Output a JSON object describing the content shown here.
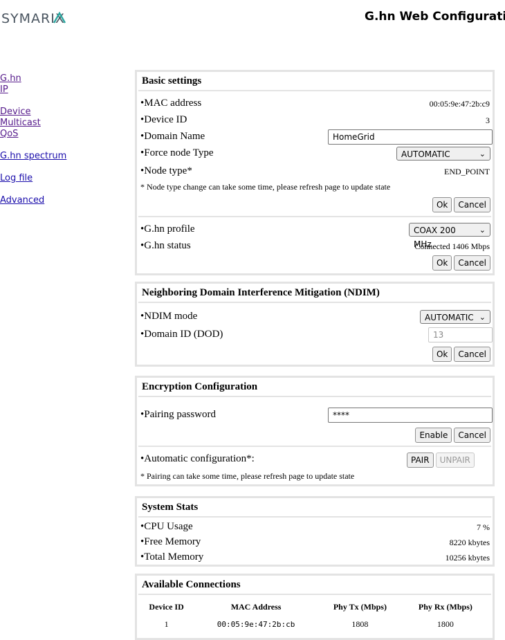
{
  "header": {
    "logo_text": "SYMARIX",
    "title": "G.hn Web Configuratio"
  },
  "nav": {
    "ghn": "G.hn",
    "ip": "IP",
    "device": "Device",
    "multicast": "Multicast",
    "qos": "QoS",
    "spectrum": "G.hn spectrum",
    "logfile": "Log file",
    "advanced": "Advanced"
  },
  "basic": {
    "title": "Basic settings",
    "mac_label": "•MAC address",
    "mac_value": "00:05:9e:47:2b:c9",
    "device_id_label": "•Device ID",
    "device_id_value": "3",
    "domain_name_label": "•Domain Name",
    "domain_name_value": "HomeGrid",
    "force_node_label": "•Force node Type",
    "force_node_value": "AUTOMATIC",
    "node_type_label": "•Node type*",
    "node_type_value": "END_POINT",
    "note": "* Node type change can take some time, please refresh page to update state",
    "ok": "Ok",
    "cancel": "Cancel",
    "profile_label": "•G.hn profile",
    "profile_value": "COAX 200 MHz",
    "status_label": "•G.hn status",
    "status_value": "Connected 1406 Mbps"
  },
  "ndim": {
    "title": "Neighboring Domain Interference Mitigation (NDIM)",
    "mode_label": "•NDIM mode",
    "mode_value": "AUTOMATIC",
    "dod_label": "•Domain ID (DOD)",
    "dod_value": "13",
    "ok": "Ok",
    "cancel": "Cancel"
  },
  "encryption": {
    "title": "Encryption Configuration",
    "password_label": "•Pairing password",
    "password_value": "****",
    "enable": "Enable",
    "cancel": "Cancel",
    "auto_label": "•Automatic configuration*:",
    "pair": "PAIR",
    "unpair": "UNPAIR",
    "note": "* Pairing can take some time, please refresh page to update state"
  },
  "stats": {
    "title": "System Stats",
    "cpu_label": "•CPU Usage",
    "cpu_value": "7 %",
    "free_label": "•Free Memory",
    "free_value": "8220 kbytes",
    "total_label": "•Total Memory",
    "total_value": "10256 kbytes"
  },
  "connections": {
    "title": "Available Connections",
    "headers": [
      "Device ID",
      "MAC Address",
      "Phy Tx (Mbps)",
      "Phy Rx (Mbps)"
    ],
    "rows": [
      [
        "1",
        "00:05:9e:47:2b:cb",
        "1808",
        "1800"
      ]
    ]
  },
  "colors": {
    "link": "#1a0dab",
    "visited": "#551a8b",
    "panel_border": "#e3e3e3",
    "logo_dark": "#4a5560",
    "logo_accent": "#2aa7a0"
  }
}
